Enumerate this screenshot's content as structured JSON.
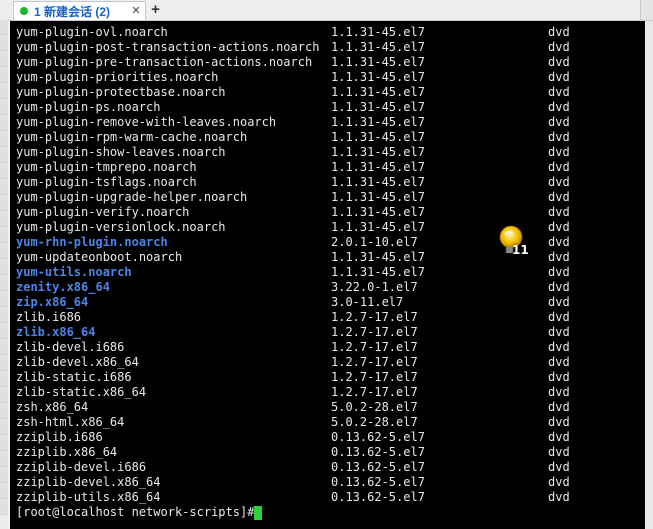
{
  "tab": {
    "title": "1 新建会话 (2)",
    "close": "✕",
    "status_color": "#1fb52b"
  },
  "new_tab_label": "+",
  "badge_count": "11",
  "packages": [
    {
      "name": "yum-plugin-ovl.noarch",
      "version": "1.1.31-45.el7",
      "repo": "dvd"
    },
    {
      "name": "yum-plugin-post-transaction-actions.noarch",
      "version": "1.1.31-45.el7",
      "repo": "dvd"
    },
    {
      "name": "yum-plugin-pre-transaction-actions.noarch",
      "version": "1.1.31-45.el7",
      "repo": "dvd"
    },
    {
      "name": "yum-plugin-priorities.noarch",
      "version": "1.1.31-45.el7",
      "repo": "dvd"
    },
    {
      "name": "yum-plugin-protectbase.noarch",
      "version": "1.1.31-45.el7",
      "repo": "dvd"
    },
    {
      "name": "yum-plugin-ps.noarch",
      "version": "1.1.31-45.el7",
      "repo": "dvd"
    },
    {
      "name": "yum-plugin-remove-with-leaves.noarch",
      "version": "1.1.31-45.el7",
      "repo": "dvd"
    },
    {
      "name": "yum-plugin-rpm-warm-cache.noarch",
      "version": "1.1.31-45.el7",
      "repo": "dvd"
    },
    {
      "name": "yum-plugin-show-leaves.noarch",
      "version": "1.1.31-45.el7",
      "repo": "dvd"
    },
    {
      "name": "yum-plugin-tmprepo.noarch",
      "version": "1.1.31-45.el7",
      "repo": "dvd"
    },
    {
      "name": "yum-plugin-tsflags.noarch",
      "version": "1.1.31-45.el7",
      "repo": "dvd"
    },
    {
      "name": "yum-plugin-upgrade-helper.noarch",
      "version": "1.1.31-45.el7",
      "repo": "dvd"
    },
    {
      "name": "yum-plugin-verify.noarch",
      "version": "1.1.31-45.el7",
      "repo": "dvd"
    },
    {
      "name": "yum-plugin-versionlock.noarch",
      "version": "1.1.31-45.el7",
      "repo": "dvd"
    },
    {
      "name": "yum-rhn-plugin.noarch",
      "version": "2.0.1-10.el7",
      "repo": "dvd",
      "highlight": true
    },
    {
      "name": "yum-updateonboot.noarch",
      "version": "1.1.31-45.el7",
      "repo": "dvd"
    },
    {
      "name": "yum-utils.noarch",
      "version": "1.1.31-45.el7",
      "repo": "dvd",
      "highlight": true
    },
    {
      "name": "zenity.x86_64",
      "version": "3.22.0-1.el7",
      "repo": "dvd",
      "highlight": true
    },
    {
      "name": "zip.x86_64",
      "version": "3.0-11.el7",
      "repo": "dvd",
      "highlight": true
    },
    {
      "name": "zlib.i686",
      "version": "1.2.7-17.el7",
      "repo": "dvd"
    },
    {
      "name": "zlib.x86_64",
      "version": "1.2.7-17.el7",
      "repo": "dvd",
      "highlight": true
    },
    {
      "name": "zlib-devel.i686",
      "version": "1.2.7-17.el7",
      "repo": "dvd"
    },
    {
      "name": "zlib-devel.x86_64",
      "version": "1.2.7-17.el7",
      "repo": "dvd"
    },
    {
      "name": "zlib-static.i686",
      "version": "1.2.7-17.el7",
      "repo": "dvd"
    },
    {
      "name": "zlib-static.x86_64",
      "version": "1.2.7-17.el7",
      "repo": "dvd"
    },
    {
      "name": "zsh.x86_64",
      "version": "5.0.2-28.el7",
      "repo": "dvd"
    },
    {
      "name": "zsh-html.x86_64",
      "version": "5.0.2-28.el7",
      "repo": "dvd"
    },
    {
      "name": "zziplib.i686",
      "version": "0.13.62-5.el7",
      "repo": "dvd"
    },
    {
      "name": "zziplib.x86_64",
      "version": "0.13.62-5.el7",
      "repo": "dvd"
    },
    {
      "name": "zziplib-devel.i686",
      "version": "0.13.62-5.el7",
      "repo": "dvd"
    },
    {
      "name": "zziplib-devel.x86_64",
      "version": "0.13.62-5.el7",
      "repo": "dvd"
    },
    {
      "name": "zziplib-utils.x86_64",
      "version": "0.13.62-5.el7",
      "repo": "dvd"
    }
  ],
  "prompt": "[root@localhost network-scripts]# ",
  "colors": {
    "terminal_bg": "#000000",
    "text": "#e8e8e8",
    "highlight_text": "#4a86e8",
    "cursor": "#2ad33a",
    "tab_title": "#1a63c8"
  }
}
